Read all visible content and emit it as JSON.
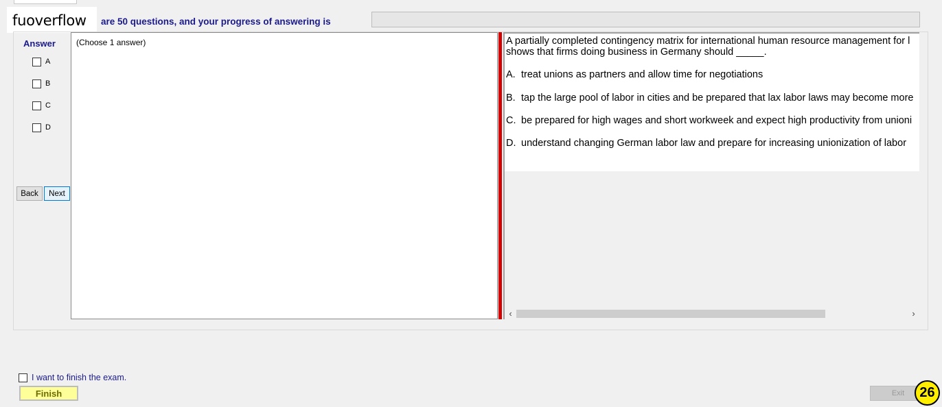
{
  "brand": {
    "text": "fuoverflow"
  },
  "header": {
    "progress_label": "are 50 questions, and your progress of answering is",
    "progress": 0
  },
  "answer_panel": {
    "title": "Answer",
    "options": [
      {
        "letter": "A",
        "checked": false
      },
      {
        "letter": "B",
        "checked": false
      },
      {
        "letter": "C",
        "checked": false
      },
      {
        "letter": "D",
        "checked": false
      }
    ],
    "back_label": "Back",
    "next_label": "Next"
  },
  "answer_area": {
    "hint": "(Choose 1 answer)"
  },
  "question": {
    "stem_line1": "A partially completed contingency matrix for international human resource management for l",
    "stem_line2": "shows that firms doing business in Germany should _____.",
    "choices": [
      {
        "letter": "A.",
        "text": "treat unions as partners and allow time for negotiations"
      },
      {
        "letter": "B.",
        "text": "tap the large pool of labor in cities and be prepared that lax labor laws may become more"
      },
      {
        "letter": "C.",
        "text": "be prepared for high wages and short workweek and expect high productivity from unioni"
      },
      {
        "letter": "D.",
        "text": "understand changing German labor law and prepare for increasing unionization of labor"
      }
    ]
  },
  "scrollbar": {
    "left_arrow": "‹",
    "right_arrow": "›"
  },
  "footer": {
    "finish_check_label": "I want to finish the exam.",
    "finish_label": "Finish",
    "exit_label": "Exit",
    "page_badge": "26"
  }
}
